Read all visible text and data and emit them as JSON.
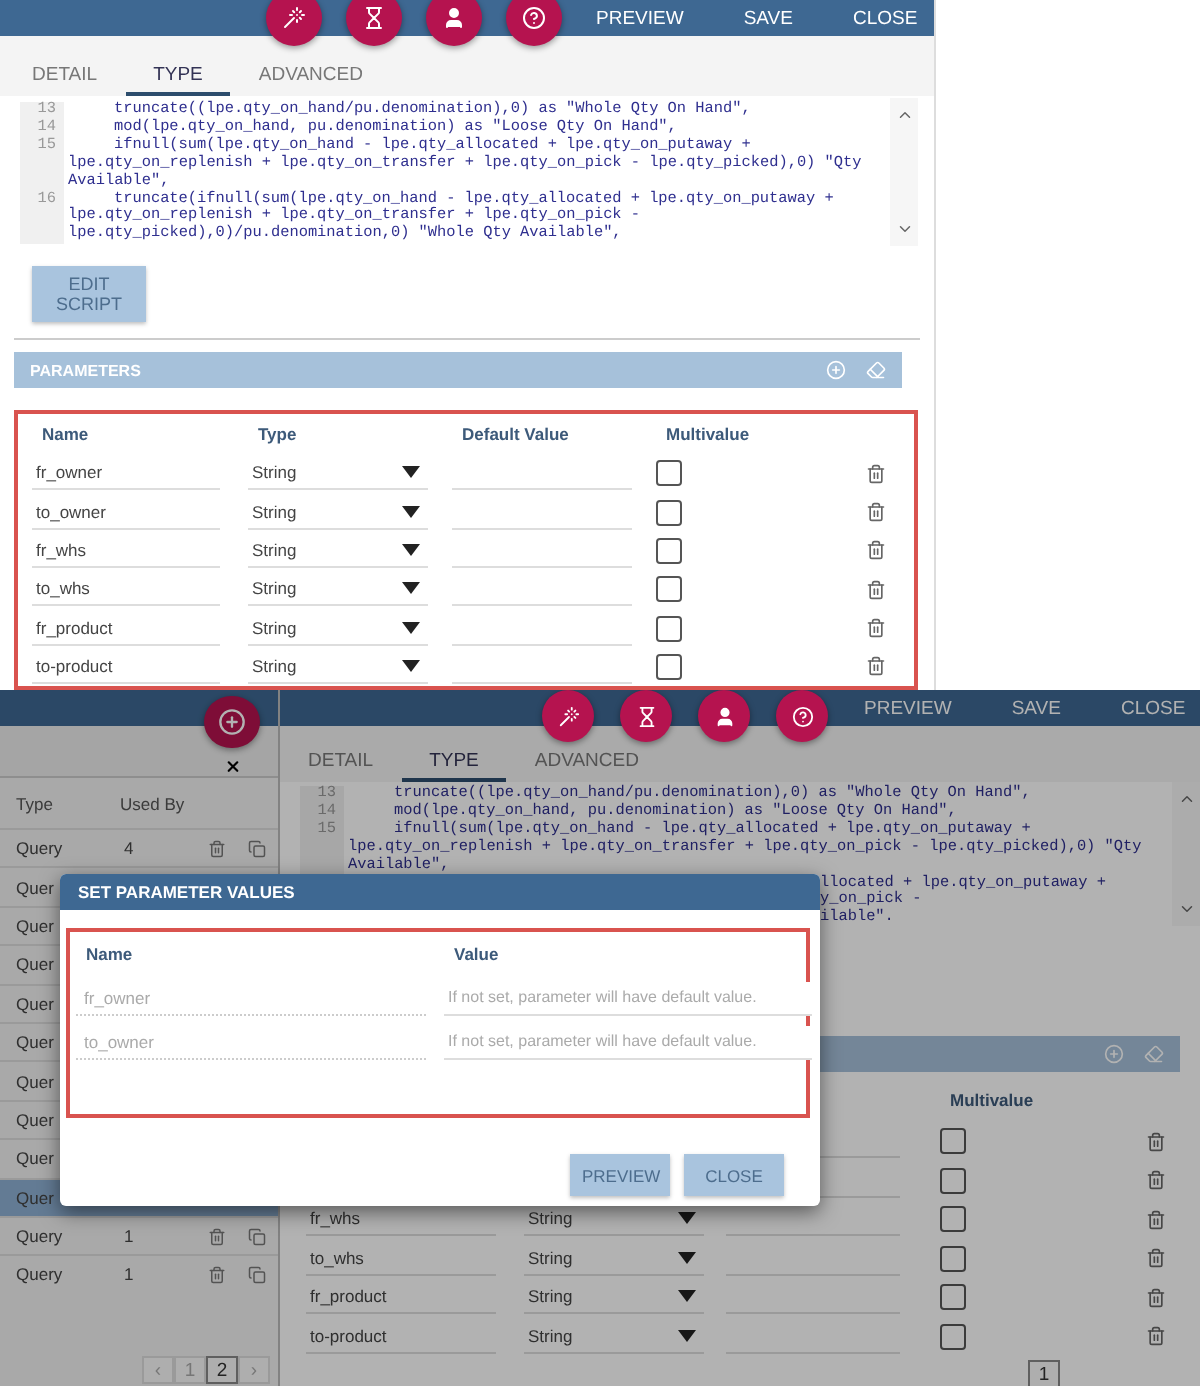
{
  "editor": {
    "toolbar_actions": [
      "PREVIEW",
      "SAVE",
      "CLOSE"
    ],
    "tabs": [
      {
        "label": "DETAIL",
        "selected": false
      },
      {
        "label": "TYPE",
        "selected": true
      },
      {
        "label": "ADVANCED",
        "selected": false
      }
    ],
    "code_lines": [
      {
        "number": "13",
        "lines": [
          "truncate((lpe.qty_on_hand/pu.denomination),0) as \"Whole Qty On Hand\","
        ]
      },
      {
        "number": "14",
        "lines": [
          "mod(lpe.qty_on_hand, pu.denomination) as \"Loose Qty On Hand\","
        ]
      },
      {
        "number": "15",
        "lines": [
          "ifnull(sum(lpe.qty_on_hand - lpe.qty_allocated + lpe.qty_on_putaway +",
          "lpe.qty_on_replenish + lpe.qty_on_transfer + lpe.qty_on_pick - lpe.qty_picked),0) \"Qty",
          "Available\","
        ]
      },
      {
        "number": "16",
        "lines": [
          "truncate(ifnull(sum(lpe.qty_on_hand - lpe.qty_allocated + lpe.qty_on_putaway +",
          "lpe.qty_on_replenish + lpe.qty_on_transfer + lpe.qty_on_pick -",
          "lpe.qty_picked),0)/pu.denomination,0) \"Whole Qty Available\","
        ]
      }
    ],
    "edit_button": "EDIT SCRIPT",
    "parameters": {
      "title": "PARAMETERS",
      "columns": [
        "Name",
        "Type",
        "Default Value",
        "Multivalue"
      ],
      "rows": [
        {
          "name": "fr_owner",
          "type": "String",
          "multivalue": false
        },
        {
          "name": "to_owner",
          "type": "String",
          "multivalue": false
        },
        {
          "name": "fr_whs",
          "type": "String",
          "multivalue": false
        },
        {
          "name": "to_whs",
          "type": "String",
          "multivalue": false
        },
        {
          "name": "fr_product",
          "type": "String",
          "multivalue": false
        },
        {
          "name": "to-product",
          "type": "String",
          "multivalue": false
        }
      ]
    }
  },
  "editor_with_dialog": {
    "sidebar": {
      "columns": [
        "Type",
        "Used By"
      ],
      "rows": [
        {
          "type": "Query",
          "used_by": "4",
          "selected": false
        },
        {
          "type": "Quer",
          "selected": false
        },
        {
          "type": "Quer",
          "selected": false
        },
        {
          "type": "Quer",
          "selected": false
        },
        {
          "type": "Quer",
          "selected": false
        },
        {
          "type": "Quer",
          "selected": false
        },
        {
          "type": "Quer",
          "selected": false
        },
        {
          "type": "Quer",
          "selected": false
        },
        {
          "type": "Quer",
          "selected": false
        },
        {
          "type": "Quer",
          "selected": true
        },
        {
          "type": "Query",
          "used_by": "1",
          "selected": false
        },
        {
          "type": "Query",
          "used_by": "1",
          "selected": false
        }
      ],
      "pagination": {
        "prev": "‹",
        "pages": [
          {
            "label": "1",
            "selected": false
          },
          {
            "label": "2",
            "selected": true
          }
        ],
        "next": "›"
      }
    },
    "toolbar_actions": [
      "PREVIEW",
      "SAVE",
      "CLOSE"
    ],
    "tabs": [
      {
        "label": "DETAIL",
        "selected": false
      },
      {
        "label": "TYPE",
        "selected": true
      },
      {
        "label": "ADVANCED",
        "selected": false
      }
    ],
    "code_lines": [
      {
        "number": "13",
        "lines": [
          "truncate((lpe.qty_on_hand/pu.denomination),0) as \"Whole Qty On Hand\","
        ]
      },
      {
        "number": "14",
        "lines": [
          "mod(lpe.qty_on_hand, pu.denomination) as \"Loose Qty On Hand\","
        ]
      },
      {
        "number": "15",
        "lines": [
          "ifnull(sum(lpe.qty_on_hand - lpe.qty_allocated + lpe.qty_on_putaway +",
          "lpe.qty_on_replenish + lpe.qty_on_transfer + lpe.qty_on_pick - lpe.qty_picked),0) \"Qty",
          "Available\","
        ]
      }
    ],
    "code_fragments": [
      "llocated + lpe.qty_on_putaway +",
      "y_on_pick -",
      "ilable\"."
    ],
    "parameters": {
      "columns": [
        "Multivalue"
      ],
      "rows": [
        {
          "multivalue": false
        },
        {
          "multivalue": false
        },
        {
          "name": "fr_whs",
          "type": "String",
          "multivalue": false
        },
        {
          "name": "to_whs",
          "type": "String",
          "multivalue": false
        },
        {
          "name": "fr_product",
          "type": "String",
          "multivalue": false
        },
        {
          "name": "to-product",
          "type": "String",
          "multivalue": false
        }
      ],
      "pagination": [
        {
          "label": "1",
          "selected": true
        }
      ]
    },
    "dialog": {
      "title": "SET PARAMETER VALUES",
      "columns": [
        "Name",
        "Value"
      ],
      "rows": [
        {
          "name": "fr_owner",
          "placeholder": "If not set, parameter will have default value."
        },
        {
          "name": "to_owner",
          "placeholder": "If not set, parameter will have default value."
        }
      ],
      "buttons": [
        "PREVIEW",
        "CLOSE"
      ]
    }
  }
}
